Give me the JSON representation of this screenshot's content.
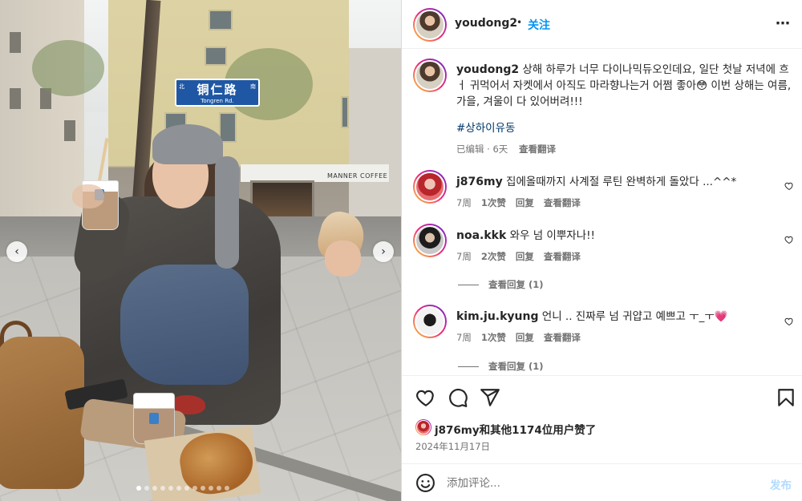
{
  "photo": {
    "street_sign": {
      "name": "铜仁路",
      "pinyin": "Tongren Rd.",
      "north": "北",
      "south": "南"
    },
    "shop_sign": "MANNER COFFEE",
    "carousel_dots": 12,
    "carousel_active": 0
  },
  "post": {
    "username": "youdong2",
    "separator": "•",
    "follow_label": "关注",
    "more_icon": "more-horizontal-icon",
    "caption_username": "youdong2",
    "caption_text": "상해 하루가 너무 다이나믹듀오인데요, 일단 첫날 저녁에 흐ㅓ 귀먹어서 자켓에서 아직도 마라향나는거 어쩜 좋아😳 이번 상해는 여름, 가을, 겨울이 다 있어버려!!!",
    "hashtag": "#상하이유동",
    "caption_meta": "已编辑 · 6天",
    "caption_translate": "查看翻译"
  },
  "comments": [
    {
      "username": "j876my",
      "text": "집에올때까지 사계절 루틴 완벽하게 돌았다 ...^^*",
      "time": "7周",
      "likes": "1次赞",
      "reply": "回复",
      "translate": "查看翻译",
      "view_replies": ""
    },
    {
      "username": "noa.kkk",
      "text": "와우 넘 이뿌자나!!",
      "time": "7周",
      "likes": "2次赞",
      "reply": "回复",
      "translate": "查看翻译",
      "view_replies": "查看回复 (1)"
    },
    {
      "username": "kim.ju.kyung",
      "text": "언니 .. 진짜루 넘 귀얍고 예쁘고 ㅜ_ㅜ💗",
      "time": "7周",
      "likes": "1次赞",
      "reply": "回复",
      "translate": "查看翻译",
      "view_replies": "查看回复 (1)"
    }
  ],
  "actions": {
    "icons": [
      "heart-icon",
      "comment-icon",
      "share-icon",
      "bookmark-icon"
    ],
    "likes_text": "j876my和其他1174位用户赞了",
    "date": "2024年11月17日"
  },
  "composer": {
    "placeholder": "添加评论...",
    "post_label": "发布",
    "emoji_icon": "emoji-icon"
  },
  "colors": {
    "accent": "#0095f6",
    "text": "#262626",
    "muted": "#737373",
    "hashtag": "#00376b"
  }
}
